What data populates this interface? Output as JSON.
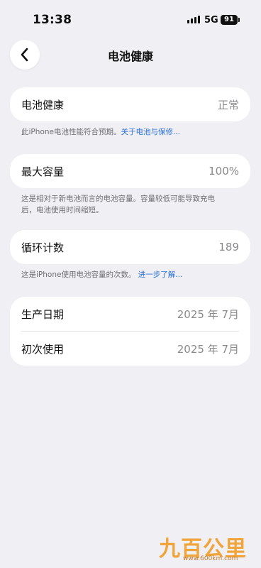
{
  "status_bar": {
    "time": "13:38",
    "network": "5G",
    "battery_level": "91"
  },
  "nav": {
    "title": "电池健康"
  },
  "health_card": {
    "label": "电池健康",
    "value": "正常"
  },
  "health_note": {
    "text": "此iPhone电池性能符合预期。",
    "link": "关于电池与保修..."
  },
  "capacity_card": {
    "label": "最大容量",
    "value": "100%"
  },
  "capacity_note": {
    "text": "这是相对于新电池而言的电池容量。容量较低可能导致充电后，电池使用时间缩短。"
  },
  "cycle_card": {
    "label": "循环计数",
    "value": "189"
  },
  "cycle_note": {
    "text": "这是iPhone使用电池容量的次数。",
    "link": "进一步了解..."
  },
  "dates_card": {
    "manufacture_label": "生产日期",
    "manufacture_value": "2025 年 7月",
    "first_use_label": "初次使用",
    "first_use_value": "2025 年 7月"
  },
  "watermark": {
    "text": "九百公里",
    "url": "www.600km.com"
  }
}
